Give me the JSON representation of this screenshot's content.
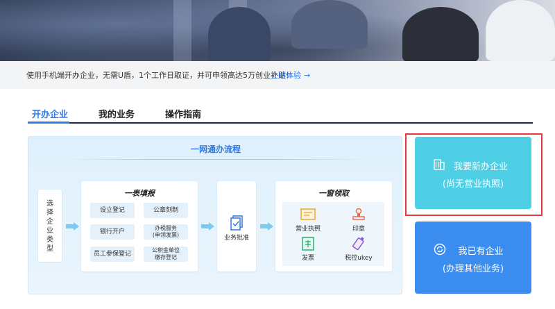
{
  "notice": {
    "text": "使用手机端开办企业，无需U盾，1个工作日取证，并可申领高达5万创业补贴！",
    "link": "立即体验",
    "arrow": "→"
  },
  "tabs": [
    {
      "label": "开办企业",
      "active": true
    },
    {
      "label": "我的业务",
      "active": false
    },
    {
      "label": "操作指南",
      "active": false
    }
  ],
  "flow": {
    "title": "一网通办流程",
    "select_type_chars": [
      "选",
      "择",
      "企",
      "业",
      "类",
      "型"
    ],
    "form": {
      "title": "一表填报",
      "items": [
        {
          "label": "设立登记"
        },
        {
          "label": "公章刻制"
        },
        {
          "label": "银行开户"
        },
        {
          "label": "办税服务",
          "sub": "(申领发票)"
        },
        {
          "label": "员工参保登记"
        },
        {
          "label": "公积金单位",
          "sub": "缴存登记"
        }
      ]
    },
    "approval": {
      "label": "业务批准",
      "icon": "document-check-icon"
    },
    "collect": {
      "title": "一窗领取",
      "items": [
        {
          "label": "营业执照",
          "icon": "license-icon"
        },
        {
          "label": "印章",
          "icon": "stamp-icon"
        },
        {
          "label": "发票",
          "icon": "invoice-icon"
        },
        {
          "label": "税控ukey",
          "icon": "ukey-icon"
        }
      ]
    }
  },
  "cards": {
    "new_company": {
      "line1": "我要新办企业",
      "line2": "(尚无营业执照)",
      "icon": "building-icon",
      "color": "#4fcfe6"
    },
    "existing_company": {
      "line1": "我已有企业",
      "line2": "(办理其他业务)",
      "icon": "refresh-circle-icon",
      "color": "#3c8df0"
    }
  },
  "colors": {
    "accent": "#2f7ae5",
    "highlight": "#e6393b"
  }
}
